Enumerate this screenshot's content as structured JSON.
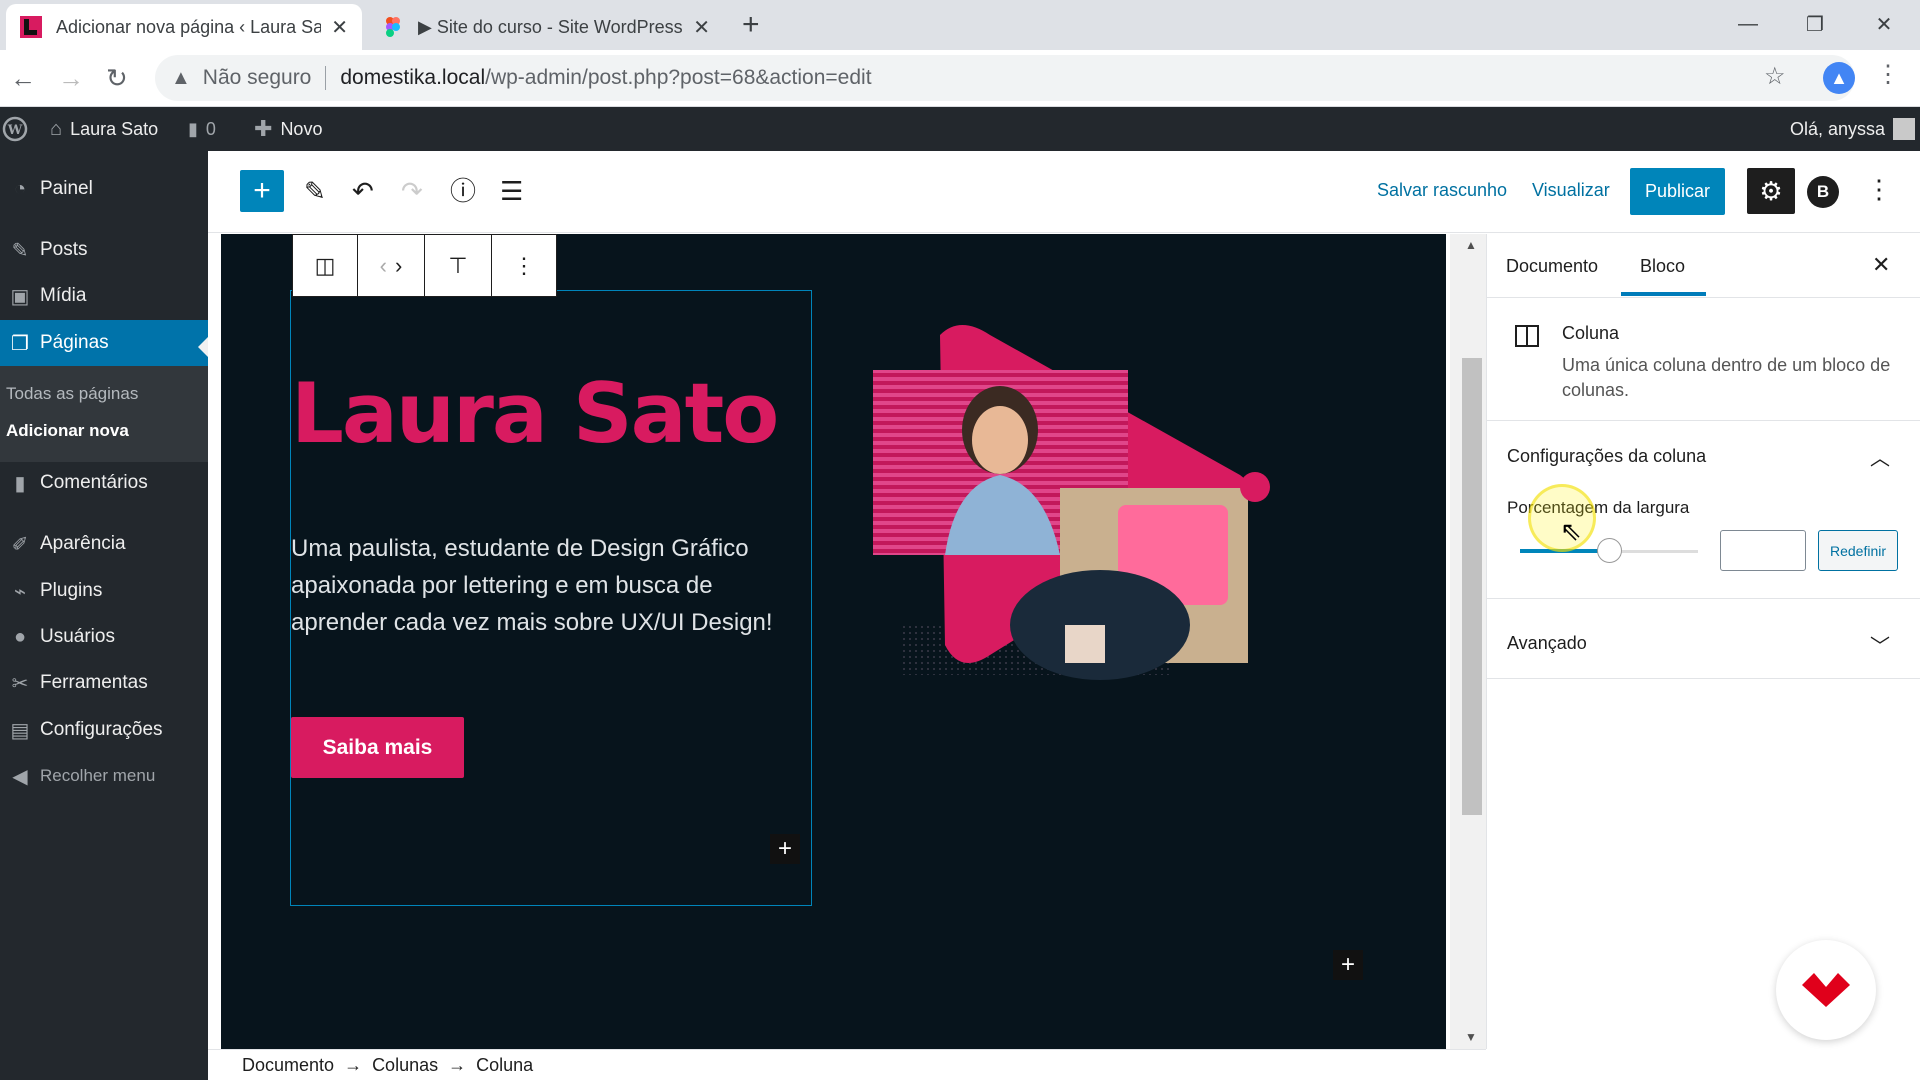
{
  "browser": {
    "tabs": [
      {
        "title": "Adicionar nova página ‹ Laura Sato",
        "active": true
      },
      {
        "title": "▶ Site do curso - Site WordPress",
        "active": false
      }
    ],
    "not_secure": "Não seguro",
    "url_host": "domestika.local",
    "url_path": "/wp-admin/post.php?post=68&action=edit",
    "colors": {
      "accent": "#4285f4"
    }
  },
  "adminbar": {
    "site_name": "Laura Sato",
    "comments_count": "0",
    "new_label": "Novo",
    "greeting": "Olá, anyssa"
  },
  "sidebar": {
    "items": [
      {
        "label": "Painel",
        "icon": "dashboard-icon"
      },
      {
        "label": "Posts",
        "icon": "pin-icon"
      },
      {
        "label": "Mídia",
        "icon": "media-icon"
      },
      {
        "label": "Páginas",
        "icon": "pages-icon"
      },
      {
        "label": "Comentários",
        "icon": "comment-icon"
      },
      {
        "label": "Aparência",
        "icon": "brush-icon"
      },
      {
        "label": "Plugins",
        "icon": "plugin-icon"
      },
      {
        "label": "Usuários",
        "icon": "users-icon"
      },
      {
        "label": "Ferramentas",
        "icon": "tools-icon"
      },
      {
        "label": "Configurações",
        "icon": "settings-icon"
      },
      {
        "label": "Recolher menu",
        "icon": "collapse-icon"
      }
    ],
    "submenu": [
      "Todas as páginas",
      "Adicionar nova"
    ]
  },
  "editor_toolbar": {
    "save_draft": "Salvar rascunho",
    "preview": "Visualizar",
    "publish": "Publicar",
    "user_initial": "B"
  },
  "canvas": {
    "heading": "Laura Sato",
    "paragraph": "Uma paulista, estudante de Design Gráfico apaixonada por lettering e em busca de aprender cada vez mais sobre UX/UI Design!",
    "button": "Saiba mais",
    "brand_color": "#d81b60"
  },
  "settings": {
    "tabs": [
      "Documento",
      "Bloco"
    ],
    "block_name": "Coluna",
    "block_description": "Uma única coluna dentro de um bloco de colunas.",
    "panel_column": "Configurações da coluna",
    "width_label": "Porcentagem da largura",
    "width_value": "",
    "reset": "Redefinir",
    "panel_advanced": "Avançado"
  },
  "breadcrumb": [
    "Documento",
    "Colunas",
    "Coluna"
  ]
}
